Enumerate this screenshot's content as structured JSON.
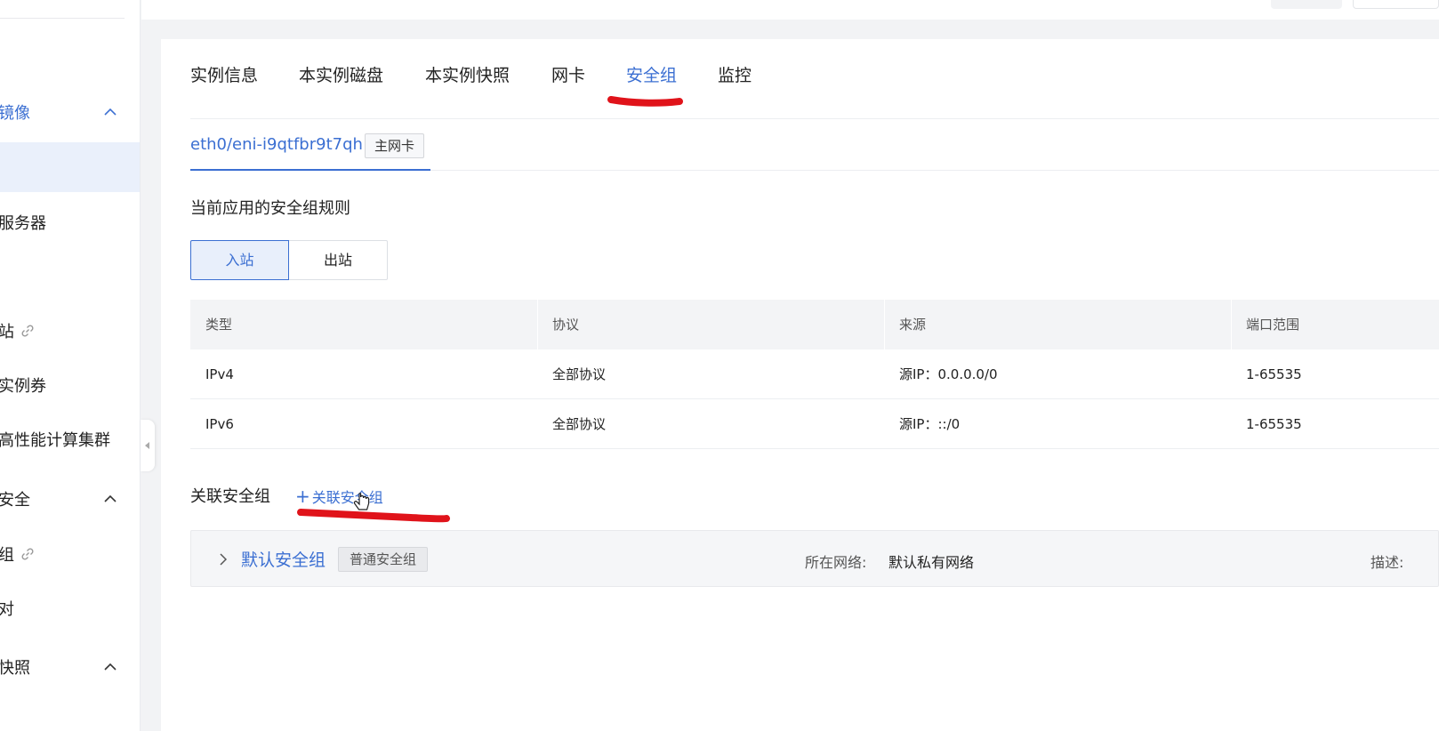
{
  "sidebar": {
    "items": [
      {
        "label": "镜像",
        "expanded": true
      },
      {
        "label": ""
      },
      {
        "label": "服务器"
      },
      {
        "label": "站"
      },
      {
        "label": "实例券"
      },
      {
        "label": "高性能计算集群"
      },
      {
        "label": "安全",
        "expanded": true
      },
      {
        "label": "组"
      },
      {
        "label": "对"
      },
      {
        "label": "快照",
        "expanded": true
      }
    ]
  },
  "tabs": [
    {
      "label": "实例信息"
    },
    {
      "label": "本实例磁盘"
    },
    {
      "label": "本实例快照"
    },
    {
      "label": "网卡"
    },
    {
      "label": "安全组",
      "active": true
    },
    {
      "label": "监控"
    }
  ],
  "nic": {
    "id": "eth0/eni-i9qtfbr9t7qh",
    "badge": "主网卡"
  },
  "rules": {
    "title": "当前应用的安全组规则",
    "direction": {
      "inbound": "入站",
      "outbound": "出站",
      "selected": "入站"
    },
    "columns": [
      "类型",
      "协议",
      "来源",
      "端口范围"
    ],
    "rows": [
      {
        "type": "IPv4",
        "protocol": "全部协议",
        "source": "源IP：0.0.0.0/0",
        "ports": "1-65535"
      },
      {
        "type": "IPv6",
        "protocol": "全部协议",
        "source": "源IP：::/0",
        "ports": "1-65535"
      }
    ]
  },
  "associate": {
    "label": "关联安全组",
    "add_label": "关联安全组",
    "add_icon": "+"
  },
  "security_group": {
    "name": "默认安全组",
    "tag": "普通安全组",
    "network_label": "所在网络:",
    "network_value": "默认私有网络",
    "desc_label": "描述:"
  },
  "colors": {
    "accent": "#3b6fd2",
    "annotation": "#e0131a"
  }
}
